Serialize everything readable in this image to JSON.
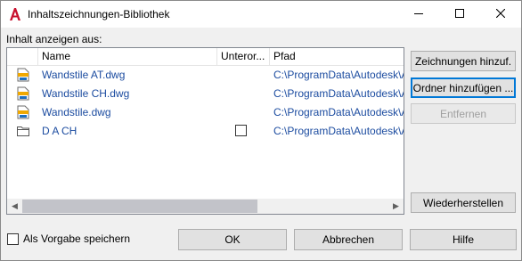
{
  "window": {
    "title": "Inhaltszeichnungen-Bibliothek"
  },
  "titlebar_controls": [
    "minimize-icon",
    "maximize-icon",
    "close-icon"
  ],
  "label_show_from": "Inhalt anzeigen aus:",
  "columns": {
    "name": "Name",
    "sub": "Unteror...",
    "path": "Pfad"
  },
  "rows": [
    {
      "icon": "dwg-file-icon",
      "name": "Wandstile AT.dwg",
      "path": "C:\\ProgramData\\Autodesk\\A"
    },
    {
      "icon": "dwg-file-icon",
      "name": "Wandstile CH.dwg",
      "path": "C:\\ProgramData\\Autodesk\\A"
    },
    {
      "icon": "dwg-file-icon",
      "name": "Wandstile.dwg",
      "path": "C:\\ProgramData\\Autodesk\\A"
    },
    {
      "icon": "folder-icon",
      "name": "D A CH",
      "path": "C:\\ProgramData\\Autodesk\\A",
      "subfolders_checked": false
    }
  ],
  "buttons": {
    "add_drawings": "Zeichnungen hinzuf.",
    "add_folder": "Ordner hinzufügen ...",
    "remove": "Entfernen",
    "restore": "Wiederherstellen",
    "ok": "OK",
    "cancel": "Abbrechen",
    "help": "Hilfe"
  },
  "save_default": {
    "label": "Als Vorgabe speichern",
    "checked": false
  },
  "colors": {
    "link_text": "#1c4ca0",
    "focus_border": "#0078d7",
    "app_icon": "#c8102e"
  }
}
